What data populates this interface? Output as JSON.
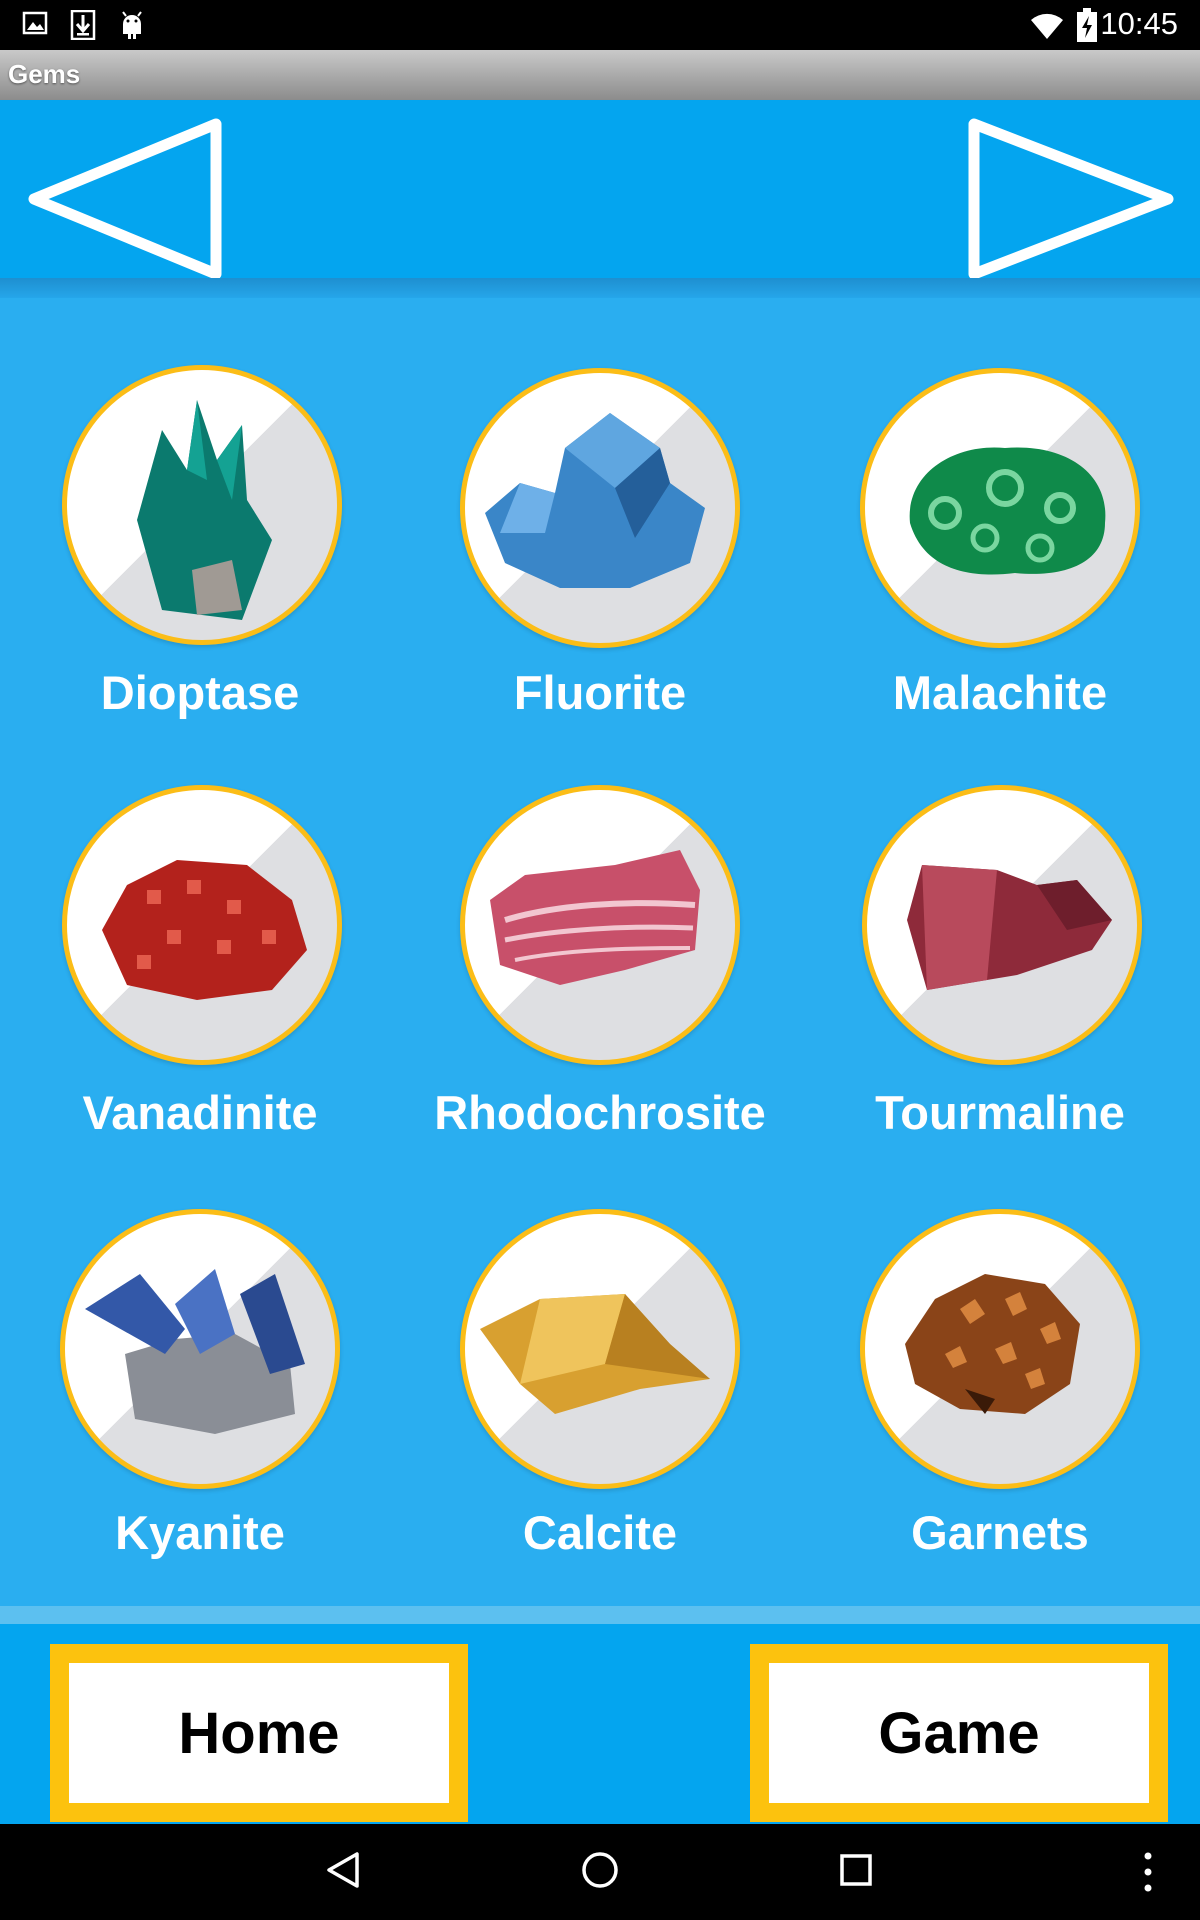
{
  "status_bar": {
    "time": "10:45",
    "icons": [
      "image-icon",
      "download-icon",
      "android-icon",
      "wifi-icon",
      "battery-charging-icon"
    ]
  },
  "app_title": "Gems",
  "nav": {
    "prev_icon": "triangle-left-icon",
    "next_icon": "triangle-right-icon"
  },
  "gems": [
    {
      "name": "Dioptase",
      "color": "#0b7a6e"
    },
    {
      "name": "Fluorite",
      "color": "#3a86c8"
    },
    {
      "name": "Malachite",
      "color": "#0f8a4a"
    },
    {
      "name": "Vanadinite",
      "color": "#b3221c"
    },
    {
      "name": "Rhodochrosite",
      "color": "#c8506a"
    },
    {
      "name": "Tourmaline",
      "color": "#8e2a3a"
    },
    {
      "name": "Kyanite",
      "color": "#3358a8"
    },
    {
      "name": "Calcite",
      "color": "#d8a030"
    },
    {
      "name": "Garnets",
      "color": "#8a4418"
    }
  ],
  "buttons": {
    "home": "Home",
    "game": "Game"
  },
  "system_nav": [
    "back-icon",
    "home-circle-icon",
    "recents-icon",
    "overflow-menu-icon"
  ],
  "colors": {
    "background": "#2aaef0",
    "header": "#04a5ef",
    "accent_border": "#fcc20e"
  }
}
